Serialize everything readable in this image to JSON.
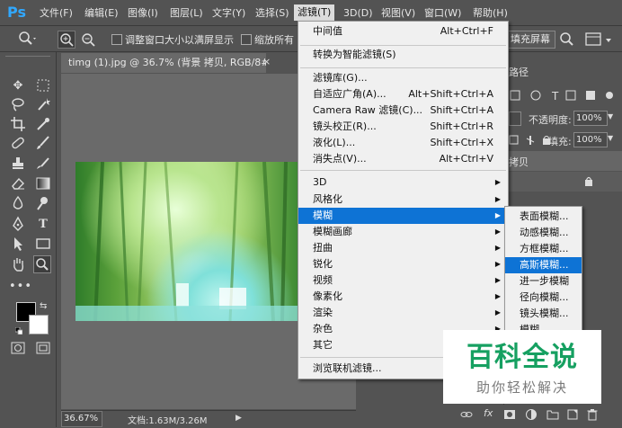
{
  "app": {
    "logo": "Ps"
  },
  "menubar": {
    "items": [
      "文件(F)",
      "编辑(E)",
      "图像(I)",
      "图层(L)",
      "文字(Y)",
      "选择(S)",
      "滤镜(T)",
      "3D(D)",
      "视图(V)",
      "窗口(W)",
      "帮助(H)"
    ]
  },
  "options": {
    "fit_label": "调整窗口大小以满屏显示",
    "zoom_all_label": "缩放所有",
    "fill_screen": "填充屏幕"
  },
  "document": {
    "tab_title": "timg (1).jpg @ 36.7% (背景 拷贝, RGB/8#) *",
    "tab_close": "×",
    "zoom": "36.67%",
    "doc_info": "文档:1.63M/3.26M"
  },
  "right_panel": {
    "header": "路径",
    "opacity_label": "不透明度:",
    "opacity_value": "100%",
    "fill_label": "填充:",
    "fill_value": "100%",
    "layer_name": "拷贝",
    "fx": "fx"
  },
  "filter_menu": {
    "items": [
      {
        "label": "中间值",
        "shortcut": "Alt+Ctrl+F"
      },
      {
        "label": "转换为智能滤镜(S)"
      },
      {
        "label": "滤镜库(G)..."
      },
      {
        "label": "自适应广角(A)...",
        "shortcut": "Alt+Shift+Ctrl+A"
      },
      {
        "label": "Camera Raw 滤镜(C)...",
        "shortcut": "Shift+Ctrl+A"
      },
      {
        "label": "镜头校正(R)...",
        "shortcut": "Shift+Ctrl+R"
      },
      {
        "label": "液化(L)...",
        "shortcut": "Shift+Ctrl+X"
      },
      {
        "label": "消失点(V)...",
        "shortcut": "Alt+Ctrl+V"
      },
      {
        "label": "3D"
      },
      {
        "label": "风格化"
      },
      {
        "label": "模糊"
      },
      {
        "label": "模糊画廊"
      },
      {
        "label": "扭曲"
      },
      {
        "label": "锐化"
      },
      {
        "label": "视频"
      },
      {
        "label": "像素化"
      },
      {
        "label": "渲染"
      },
      {
        "label": "杂色"
      },
      {
        "label": "其它"
      },
      {
        "label": "浏览联机滤镜..."
      }
    ]
  },
  "blur_submenu": {
    "items": [
      "表面模糊...",
      "动感模糊...",
      "方框模糊...",
      "高斯模糊...",
      "进一步模糊",
      "径向模糊...",
      "镜头模糊...",
      "模糊"
    ]
  },
  "watermark": {
    "title": "百科全说",
    "subtitle": "助你轻松解决"
  },
  "colors": {
    "highlight": "#0e73d5",
    "watermark_green": "#16a061",
    "ps_blue": "#31a8ff"
  }
}
